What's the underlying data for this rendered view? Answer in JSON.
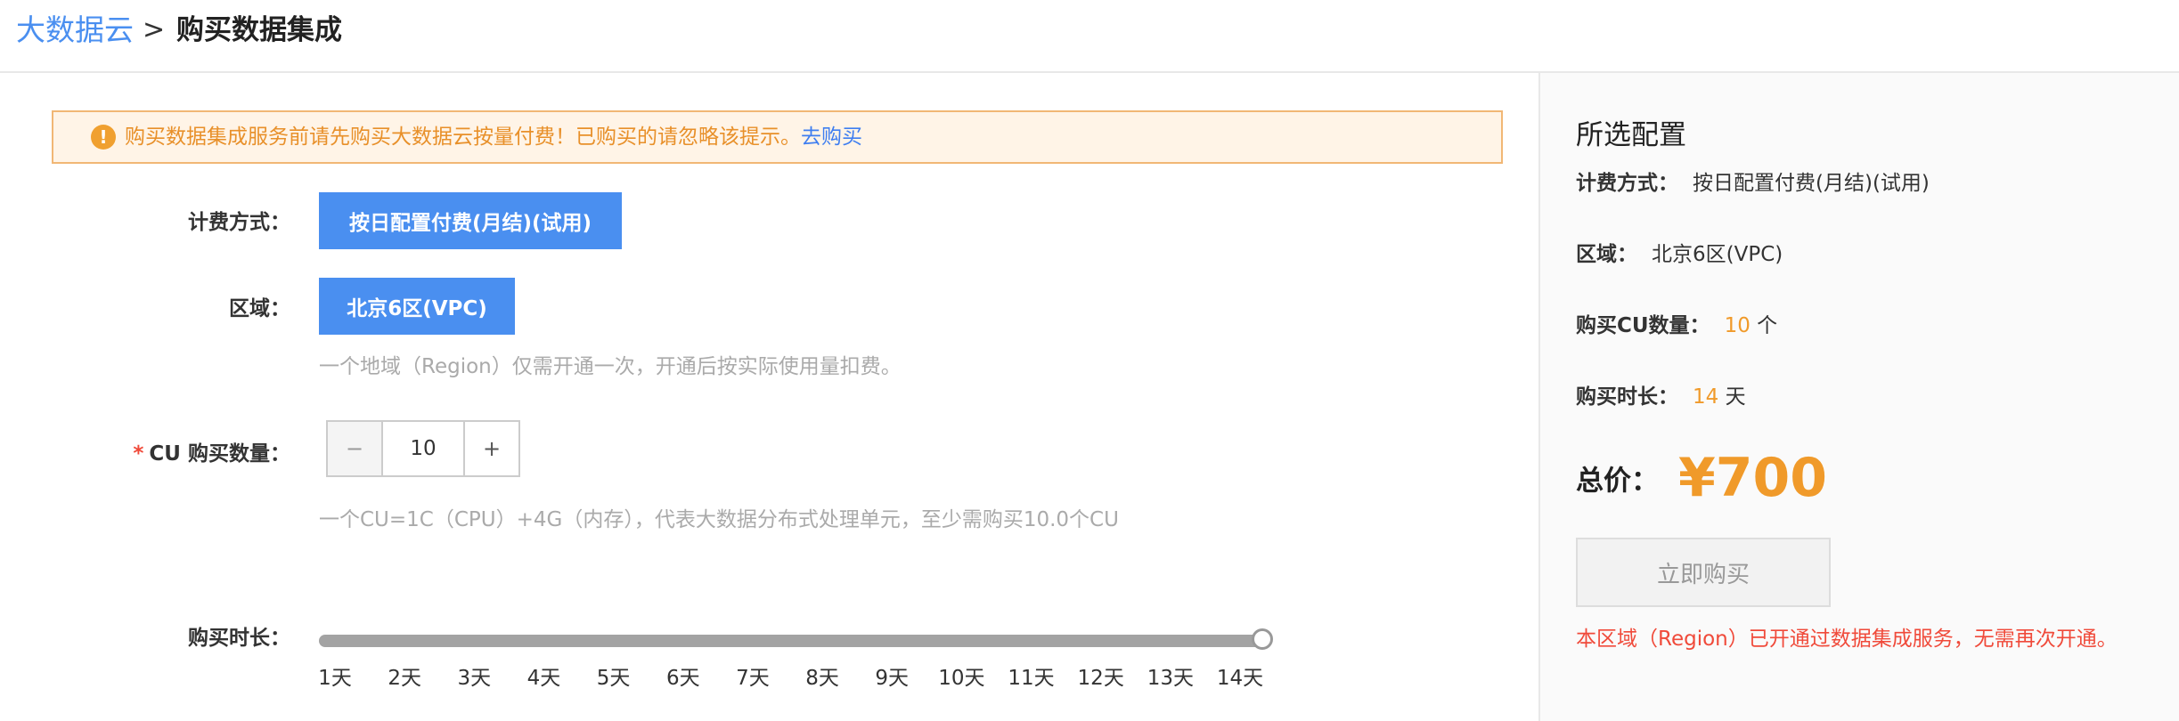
{
  "header": {
    "breadcrumb_home": "大数据云",
    "separator": ">",
    "breadcrumb_current": "购买数据集成"
  },
  "alert": {
    "icon": "exclamation-circle-icon",
    "text": "购买数据集成服务前请先购买大数据云按量付费！已购买的请忽略该提示。",
    "link": "去购买",
    "colors": {
      "background": "#fff4e7",
      "border": "#f1b775",
      "text": "#e8902a",
      "link": "#3f7ef0"
    }
  },
  "form": {
    "billing": {
      "label": "计费方式：",
      "option": "按日配置付费(月结)(试用)"
    },
    "region": {
      "label": "区域：",
      "option": "北京6区(VPC)",
      "hint": "一个地域（Region）仅需开通一次，开通后按实际使用量扣费。"
    },
    "cu": {
      "required_mark": "*",
      "label": "CU 购买数量：",
      "minus": "−",
      "value": "10",
      "plus": "+",
      "hint": "一个CU=1C（CPU）+4G（内存），代表大数据分布式处理单元，至少需购买10.0个CU"
    },
    "duration": {
      "label": "购买时长：",
      "ticks": [
        "1天",
        "2天",
        "3天",
        "4天",
        "5天",
        "6天",
        "7天",
        "8天",
        "9天",
        "10天",
        "11天",
        "12天",
        "13天",
        "14天"
      ],
      "selected_days": 14,
      "max_days": 14
    }
  },
  "summary": {
    "title": "所选配置",
    "billing_key": "计费方式：",
    "billing_val": "按日配置付费(月结)(试用)",
    "region_key": "区域：",
    "region_val": "北京6区(VPC)",
    "cu_key": "购买CU数量：",
    "cu_val": "10",
    "cu_unit": "个",
    "duration_key": "购买时长：",
    "duration_val": "14",
    "duration_unit": "天",
    "total_label": "总价：",
    "total_price": "¥700",
    "buy_button": "立即购买",
    "note": "本区域（Region）已开通过数据集成服务，无需再次开通。"
  },
  "colors": {
    "accent": "#4a8ff0",
    "price": "#f09a2a",
    "error": "#f04a3a"
  }
}
